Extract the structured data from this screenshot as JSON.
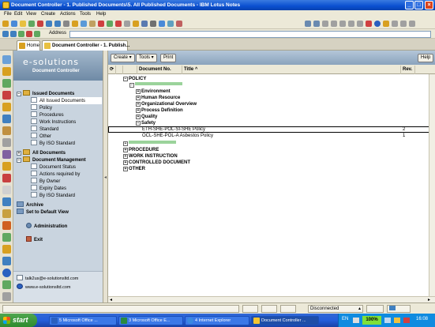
{
  "window": {
    "title": "Document Controller - 1. Published Documents\\5. All Published Documents - IBM Lotus Notes"
  },
  "menu": [
    "File",
    "Edit",
    "View",
    "Create",
    "Actions",
    "Tools",
    "Help"
  ],
  "address": {
    "label": "Address",
    "value": ""
  },
  "tabs": [
    {
      "label": "Home"
    },
    {
      "label": "Document Controller - 1. Publish..."
    }
  ],
  "navigator": {
    "logo": "e-solutions",
    "subtitle": "Document Controller",
    "items": [
      {
        "label": "Issued Documents",
        "level": 0,
        "bold": true,
        "type": "toggle",
        "toggle": "−"
      },
      {
        "label": "All Issued Documents",
        "level": 1,
        "selected": true,
        "type": "doc"
      },
      {
        "label": "Policy",
        "level": 1,
        "type": "doc"
      },
      {
        "label": "Procedures",
        "level": 1,
        "type": "doc"
      },
      {
        "label": "Work Instructions",
        "level": 1,
        "type": "doc"
      },
      {
        "label": "Standard",
        "level": 1,
        "type": "doc"
      },
      {
        "label": "Other",
        "level": 1,
        "type": "doc"
      },
      {
        "label": "By ISO Standard",
        "level": 1,
        "type": "doc"
      },
      {
        "label": "All Documents",
        "level": 0,
        "bold": true,
        "type": "toggle",
        "toggle": "+"
      },
      {
        "label": "Document Management",
        "level": 0,
        "bold": true,
        "type": "toggle",
        "toggle": "−"
      },
      {
        "label": "Document Status",
        "level": 1,
        "type": "doc"
      },
      {
        "label": "Actions required by",
        "level": 1,
        "type": "doc"
      },
      {
        "label": "By Owner",
        "level": 1,
        "type": "doc"
      },
      {
        "label": "Expiry Dates",
        "level": 1,
        "type": "doc"
      },
      {
        "label": "By ISO Standard",
        "level": 1,
        "type": "doc"
      },
      {
        "label": "Archive",
        "level": 0,
        "bold": true,
        "type": "icon"
      },
      {
        "label": "Set to Default View",
        "level": 0,
        "bold": true,
        "type": "icon"
      }
    ],
    "admin": "Administration",
    "exit": "Exit",
    "email": "talk2us@e-solutionsltd.com",
    "website": "www.e-solutionsltd.com"
  },
  "actions": {
    "create": "Create",
    "tools": "Tools",
    "print": "Print",
    "help": "Help"
  },
  "columns": {
    "docno": "Document No.",
    "title": "Title",
    "sort": "^",
    "rev": "Rev."
  },
  "view_rows": [
    {
      "indent": 0,
      "toggle": "−",
      "label": "POLICY",
      "bold": true
    },
    {
      "indent": 1,
      "toggle": "−",
      "label": "",
      "bar": true
    },
    {
      "indent": 2,
      "toggle": "+",
      "label": "Environment",
      "bold": true
    },
    {
      "indent": 2,
      "toggle": "+",
      "label": "Human Resource",
      "bold": true
    },
    {
      "indent": 2,
      "toggle": "+",
      "label": "Organizational Overview",
      "bold": true
    },
    {
      "indent": 2,
      "toggle": "+",
      "label": "Process Definition",
      "bold": true
    },
    {
      "indent": 2,
      "toggle": "+",
      "label": "Quality",
      "bold": true
    },
    {
      "indent": 2,
      "toggle": "−",
      "label": "Safety",
      "bold": true
    },
    {
      "indent": 3,
      "toggle": "",
      "label": "ETH-SHE-POL-SI-SHE Policy",
      "rev": "2",
      "focused": true
    },
    {
      "indent": 3,
      "toggle": "",
      "label": "OCL-SHE-POL-A Asbestos Policy",
      "rev": "1"
    },
    {
      "indent": 0,
      "toggle": "+",
      "label": "",
      "bar": true
    },
    {
      "indent": 0,
      "toggle": "+",
      "label": "PROCEDURE",
      "bold": true
    },
    {
      "indent": 0,
      "toggle": "+",
      "label": "WORK INSTRUCTION",
      "bold": true
    },
    {
      "indent": 0,
      "toggle": "+",
      "label": "CONTROLLED DOCUMENT",
      "bold": true
    },
    {
      "indent": 0,
      "toggle": "+",
      "label": "OTHER",
      "bold": true
    }
  ],
  "status": {
    "connection": "Disconnected"
  },
  "taskbar": {
    "start": "start",
    "tasks": [
      {
        "label": "5 Microsoft Office ..."
      },
      {
        "label": "3 Microsoft Office E..."
      },
      {
        "label": "4 Internet Explorer"
      },
      {
        "label": "Document Controller ..."
      }
    ],
    "lang": "EN",
    "zoom": "100%",
    "clock": "16:08"
  },
  "colors": {
    "titlebar": "#0a4fd0",
    "navigator": "#c9d4df",
    "actionbar": "#8aa3bd",
    "taskbar": "#245edb"
  }
}
